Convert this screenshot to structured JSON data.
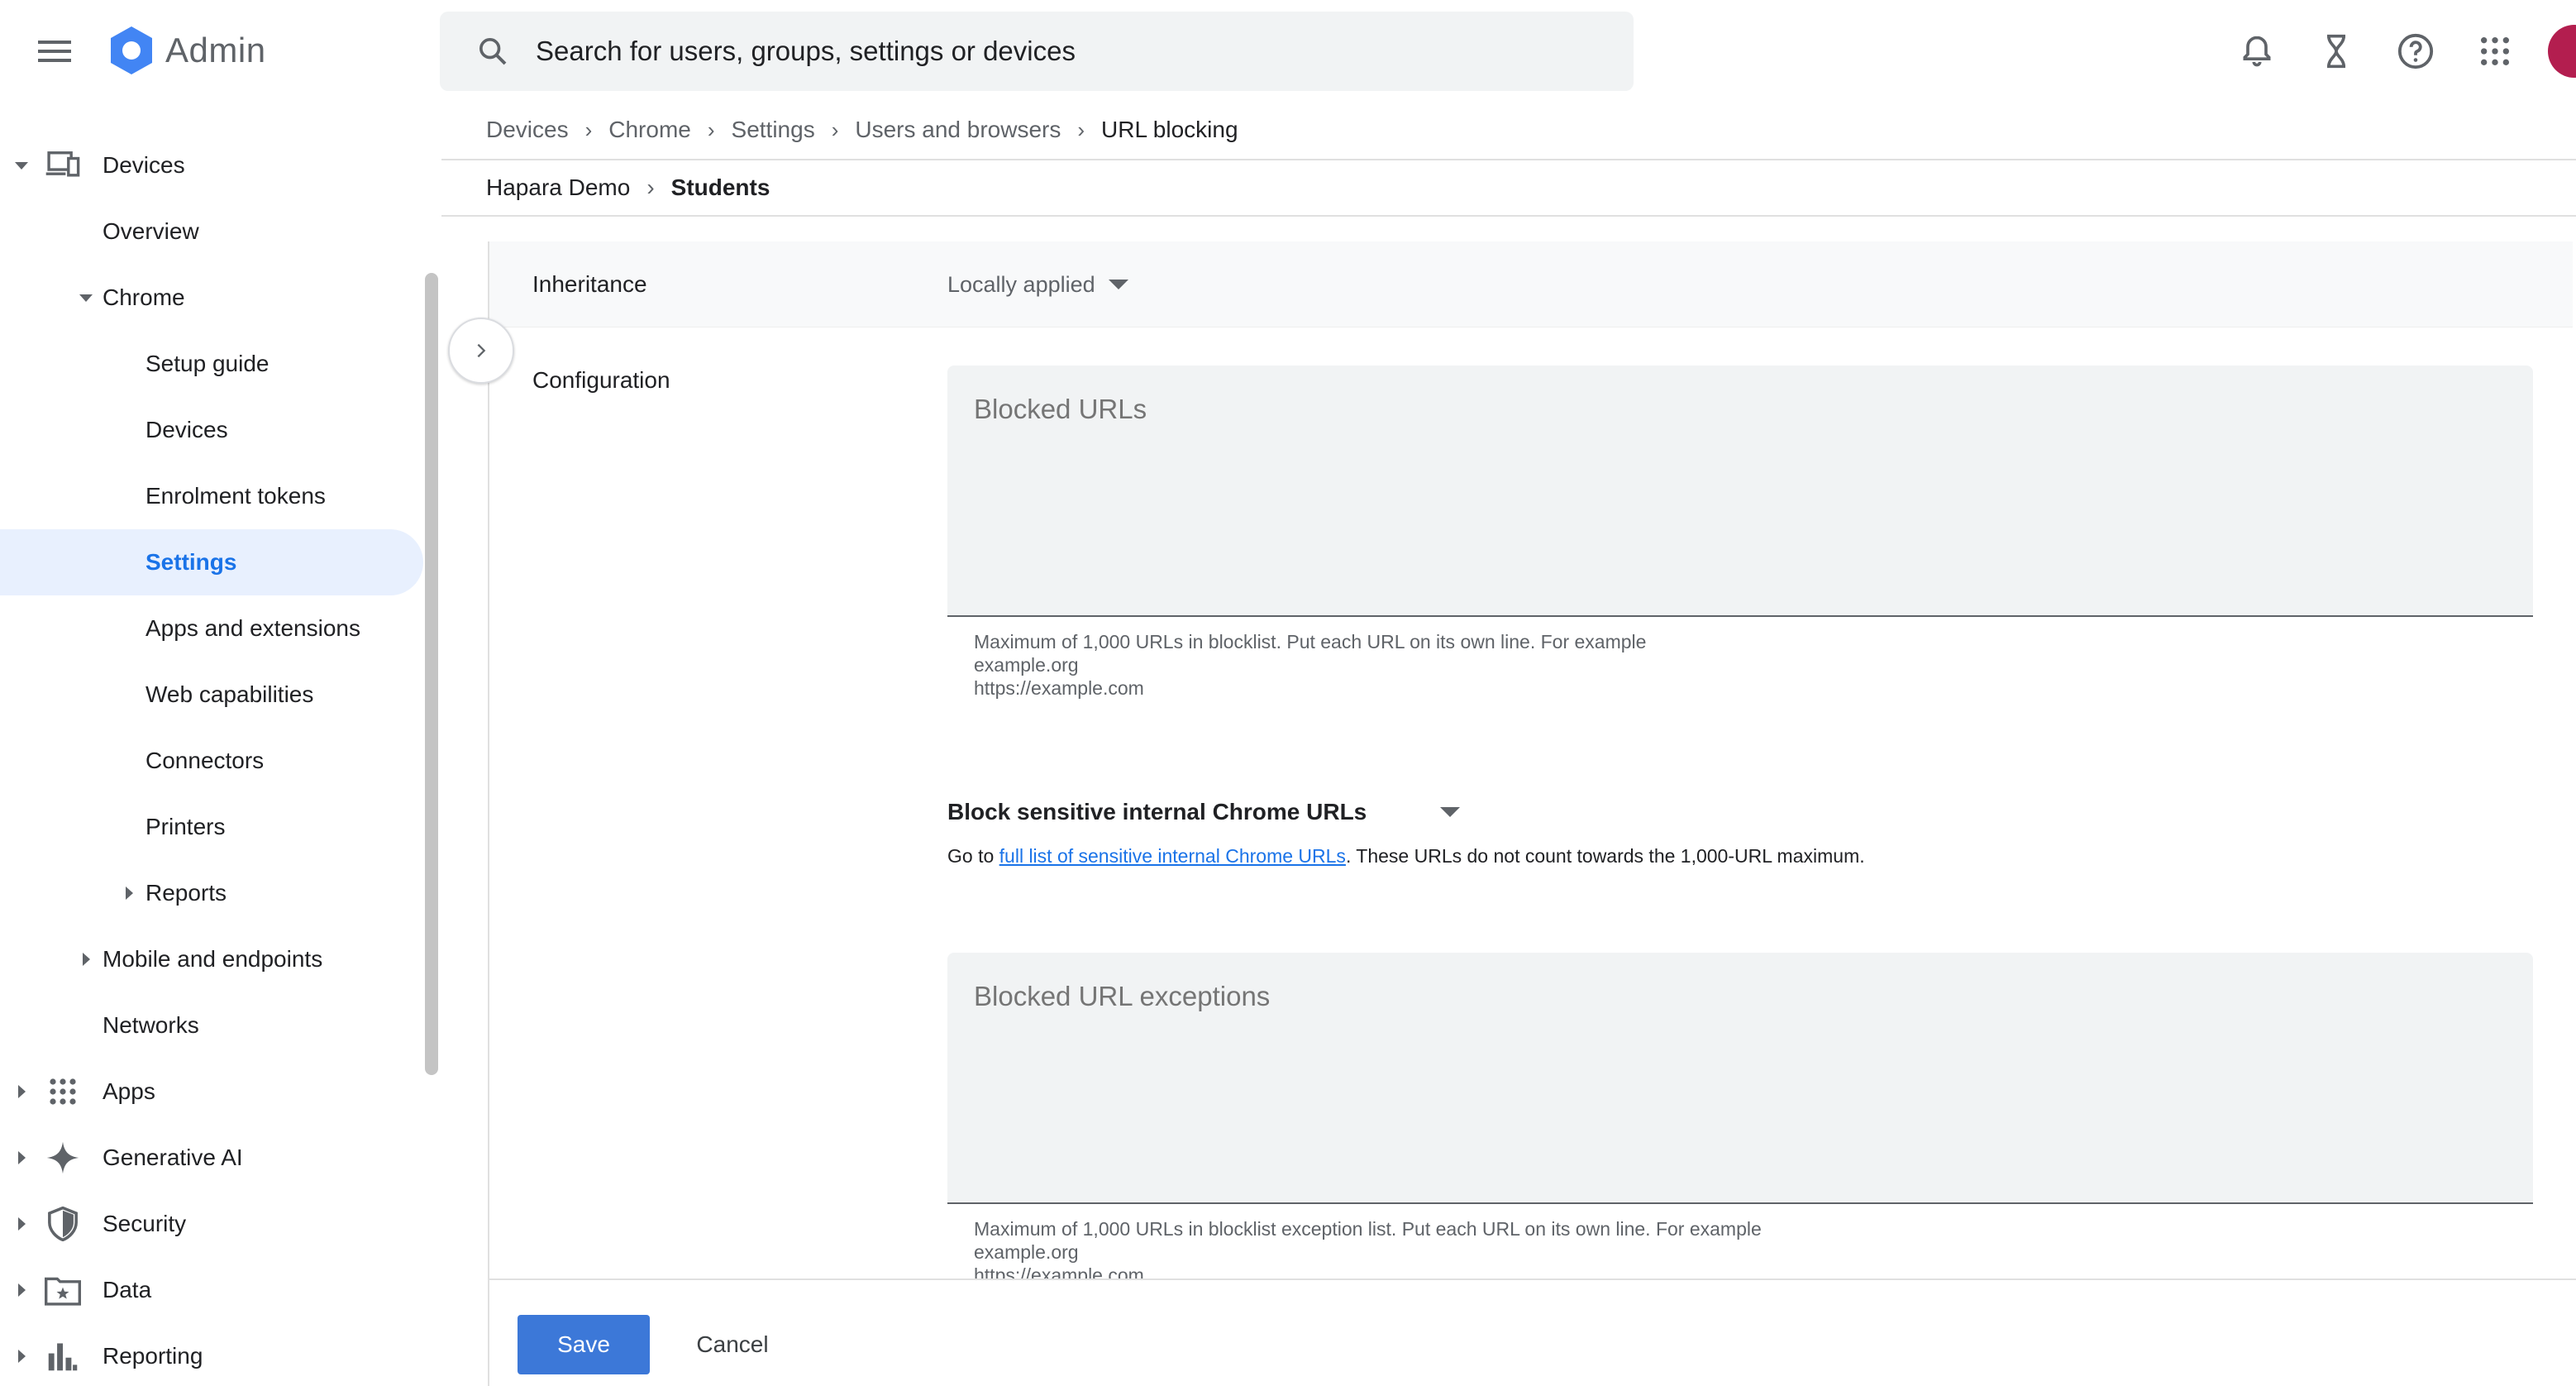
{
  "app": {
    "title": "Admin",
    "logo_icon": "google-admin-hexagon-icon"
  },
  "search": {
    "placeholder": "Search for users, groups, settings or devices"
  },
  "top_icons": [
    "notifications-bell-icon",
    "hourglass-tasks-icon",
    "help-icon",
    "apps-grid-icon",
    "account-avatar"
  ],
  "sidebar": {
    "items": [
      {
        "label": "Devices",
        "icon": "devices-icon",
        "expanded": true
      },
      {
        "label": "Overview"
      },
      {
        "label": "Chrome",
        "expanded": true
      },
      {
        "label": "Setup guide"
      },
      {
        "label": "Devices"
      },
      {
        "label": "Enrolment tokens"
      },
      {
        "label": "Settings",
        "active": true
      },
      {
        "label": "Apps and extensions"
      },
      {
        "label": "Web capabilities"
      },
      {
        "label": "Connectors"
      },
      {
        "label": "Printers"
      },
      {
        "label": "Reports",
        "collapsed": true
      },
      {
        "label": "Mobile and endpoints",
        "collapsed": true
      },
      {
        "label": "Networks"
      },
      {
        "label": "Apps",
        "icon": "apps-grid-icon",
        "collapsed": true
      },
      {
        "label": "Generative AI",
        "icon": "sparkle-icon",
        "collapsed": true
      },
      {
        "label": "Security",
        "icon": "shield-icon",
        "collapsed": true
      },
      {
        "label": "Data",
        "icon": "folder-star-icon",
        "collapsed": true
      },
      {
        "label": "Reporting",
        "icon": "bar-chart-icon",
        "collapsed": true
      }
    ]
  },
  "breadcrumb": [
    "Devices",
    "Chrome",
    "Settings",
    "Users and browsers",
    "URL blocking"
  ],
  "org_unit": {
    "parent": "Hapara Demo",
    "current": "Students"
  },
  "setting": {
    "inheritance_label": "Inheritance",
    "inheritance_value": "Locally applied",
    "configuration_label": "Configuration",
    "blocked_urls_placeholder": "Blocked URLs",
    "blocked_urls_help": [
      "Maximum of 1,000 URLs in blocklist. Put each URL on its own line. For example",
      "example.org",
      "https://example.com"
    ],
    "sensitive_label": "Block sensitive internal Chrome URLs",
    "sensitive_help_prefix": "Go to ",
    "sensitive_help_link": "full list of sensitive internal Chrome URLs",
    "sensitive_help_suffix": ". These URLs do not count towards the 1,000-URL maximum.",
    "exceptions_placeholder": "Blocked URL exceptions",
    "exceptions_help": [
      "Maximum of 1,000 URLs in blocklist exception list. Put each URL on its own line. For example",
      "example.org",
      "https://example.com"
    ]
  },
  "footer": {
    "save_label": "Save",
    "cancel_label": "Cancel"
  },
  "colors": {
    "accent": "#1a73e8",
    "save_button": "#3c78d8",
    "avatar": "#b31e4f",
    "active_nav_bg": "#e8f0fe"
  }
}
